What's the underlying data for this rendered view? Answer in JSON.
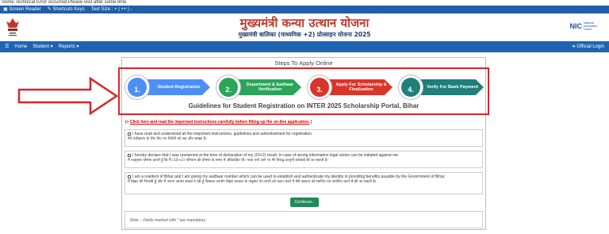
{
  "error_bar": "Some Technical Error occurred,Please visit after some time",
  "accessibility": {
    "screen_reader": "Screen Reader",
    "shortcut_keys": "Shortcuts Keys",
    "text_size": "Text Size : + | ++ | -"
  },
  "banner": {
    "title_hindi": "मुख्यमंत्री कन्या उत्थान योजना",
    "subtitle_hindi": "मुख्यमंत्री बालिका (माध्यमिक +2) प्रोत्साहन योजना 2025",
    "nic_logo": "NIC",
    "nic_text": "National Informatics Centre"
  },
  "nav": {
    "home": "Home",
    "student": "Student",
    "reports": "Reports",
    "login": "Official Login"
  },
  "card_title": "Steps To Apply Online",
  "steps": [
    {
      "number": "1.",
      "label": "Student Registration",
      "color": "#4c8ff5"
    },
    {
      "number": "2.",
      "label": "Department & Aadhaar Verification",
      "color": "#2aa55a"
    },
    {
      "number": "3.",
      "label": "Apply For Scholarship & Finalization",
      "color": "#d9352a"
    },
    {
      "number": "4.",
      "label": "Verify For Bank Payment",
      "color": "#1f7f7a"
    }
  ],
  "guidelines_title": "Guidelines for Student Registration on INTER 2025 Scholarship Portal, Bihar",
  "instructions_link": "Click here and read the important instructions carefully before filling-up the on-line application.",
  "declarations": [
    {
      "en": "I have read and understood all the important instructions, guidelines and advertisement for registration.",
      "hi": "मैंने पंजीकरण के लिए दिए गए निर्देशों को पढ़ा और समझा है।"
    },
    {
      "en": "I hereby declare that I was unmarried at the time of declaration of my (10+2) result. In case of wrong information legal action can be initiated against me.",
      "hi": "मैं एतद्द्वारा घोषणा करती हूँ कि मैं (10+2) परिणाम की घोषणा के समय में अविवाहित थी। गलत पाये जाने पर मेरे विरुद्ध क़ानूनी कार्रवाई की जा सकती है।"
    },
    {
      "en": "I am a resident of Bihar and I am giving my aadhaar number which can be used to establish and authenticate my identity in providing benefits payable by the Government of Bihar.",
      "hi": "मैं बिहार की निवासी हूँ और मैं अपना आधार संख्या दे रही हूँ जिसका उपयोग बिहार सरकार के अनुसार देय लाभों को प्रदान करने में मेरी पहचान को स्थापित एवं प्रमाणित करने में की जा सकती है।"
    }
  ],
  "continue_label": "Continue..",
  "note": "Note :- Fields marked with * are mandatory.",
  "colors": {
    "accent_blue": "#1f64b0",
    "highlight_red": "#d9252a",
    "continue_green": "#1f8a5a"
  }
}
